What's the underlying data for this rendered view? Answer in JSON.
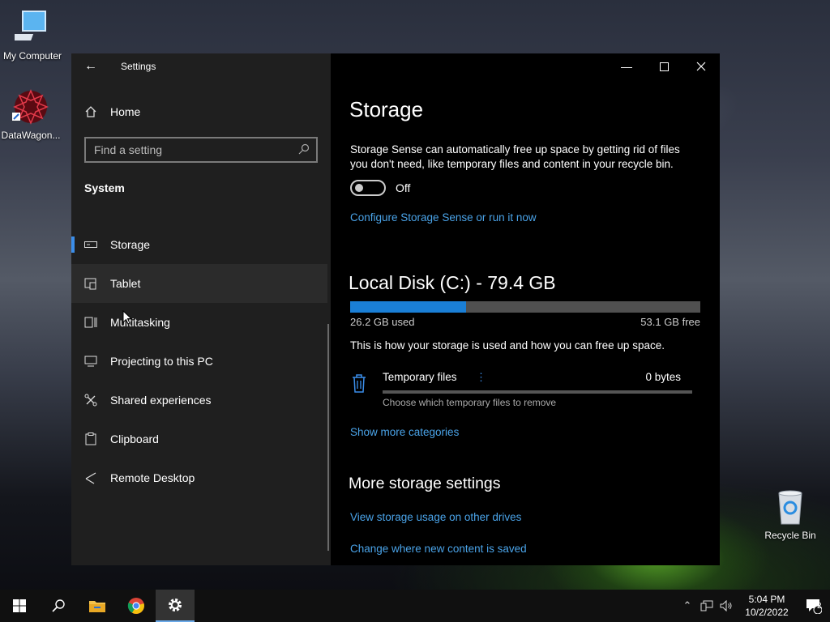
{
  "desktop": {
    "icons": [
      {
        "label": "My Computer"
      },
      {
        "label": "DataWagon..."
      },
      {
        "label": "Recycle Bin"
      }
    ]
  },
  "window": {
    "title": "Settings",
    "sidebar": {
      "home_label": "Home",
      "search_placeholder": "Find a setting",
      "section_title": "System",
      "items": [
        {
          "label": "Storage",
          "icon": "storage-icon",
          "active": true
        },
        {
          "label": "Tablet",
          "icon": "tablet-icon",
          "hover": true
        },
        {
          "label": "Multitasking",
          "icon": "multitasking-icon"
        },
        {
          "label": "Projecting to this PC",
          "icon": "projecting-icon"
        },
        {
          "label": "Shared experiences",
          "icon": "shared-experiences-icon"
        },
        {
          "label": "Clipboard",
          "icon": "clipboard-icon"
        },
        {
          "label": "Remote Desktop",
          "icon": "remote-desktop-icon"
        }
      ]
    },
    "main": {
      "title": "Storage",
      "description": "Storage Sense can automatically free up space by getting rid of files you don't need, like temporary files and content in your recycle bin.",
      "storage_sense_state": "Off",
      "configure_link": "Configure Storage Sense or run it now",
      "disk_title": "Local Disk (C:) - 79.4 GB",
      "disk_used_fraction": 0.33,
      "used_label": "26.2 GB used",
      "free_label": "53.1 GB free",
      "usage_note": "This is how your storage is used and how you can free up space.",
      "categories": [
        {
          "name": "Temporary files",
          "size": "0 bytes",
          "subtitle": "Choose which temporary files to remove"
        }
      ],
      "show_more_link": "Show more categories",
      "more_settings_title": "More storage settings",
      "more_links": [
        "View storage usage on other drives",
        "Change where new content is saved"
      ]
    }
  },
  "taskbar": {
    "time": "5:04 PM",
    "date": "10/2/2022",
    "notification_count": "2"
  },
  "colors": {
    "accent": "#3b8eea",
    "link": "#4aa3e8",
    "disk_used": "#1a7fd6"
  }
}
